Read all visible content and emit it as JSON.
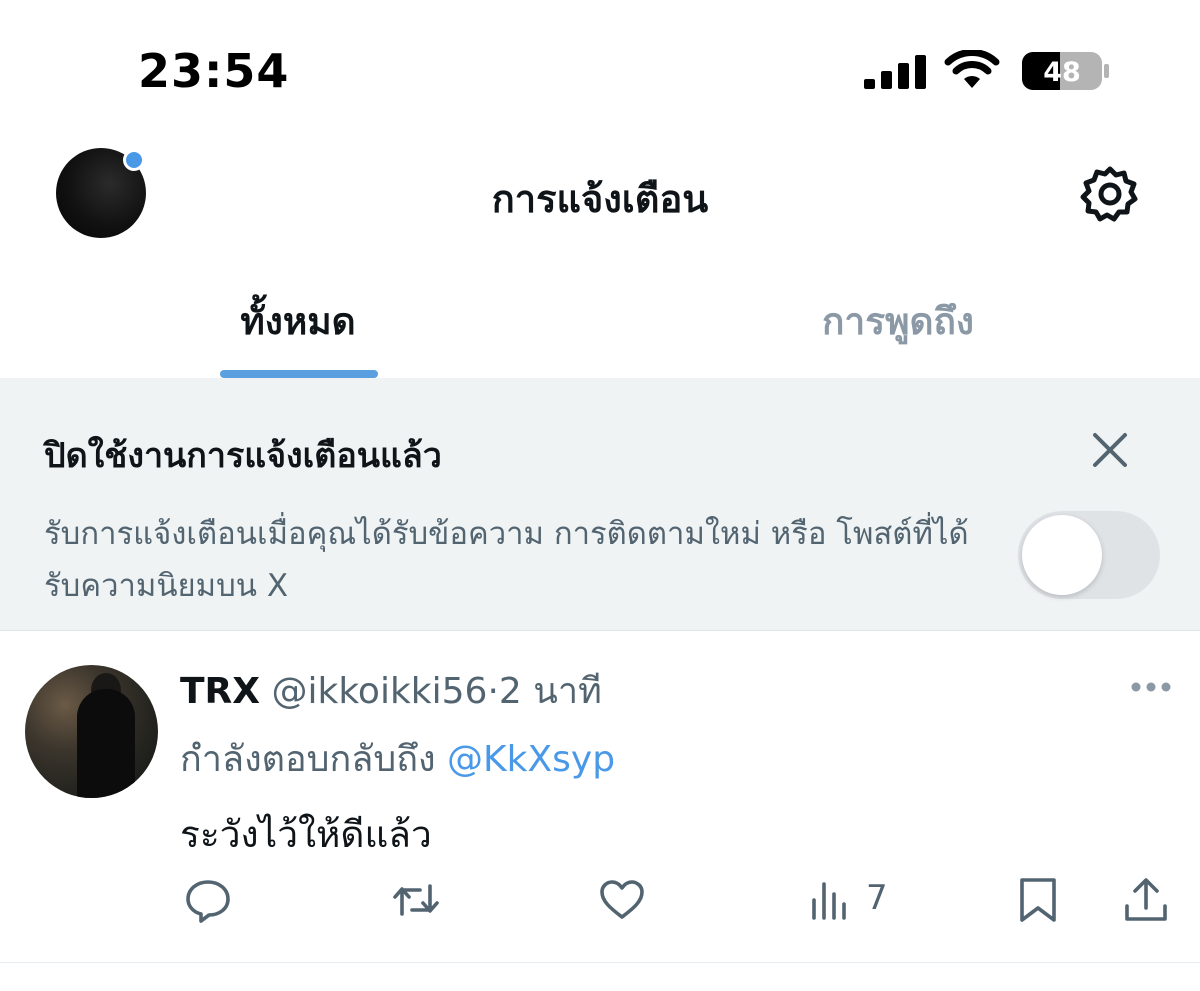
{
  "status_bar": {
    "time": "23:54",
    "battery": "48"
  },
  "header": {
    "title": "การแจ้งเตือน"
  },
  "tabs": [
    {
      "label": "ทั้งหมด"
    },
    {
      "label": "การพูดถึง"
    }
  ],
  "banner": {
    "title": "ปิดใช้งานการแจ้งเตือนแล้ว",
    "description": "รับการแจ้งเตือนเมื่อคุณได้รับข้อความ การติดตามใหม่ หรือ โพสต์ที่ได้รับความนิยมบน X",
    "toggle_on": false
  },
  "post": {
    "author_name": "TRX",
    "author_handle": "@ikkoikki56",
    "separator": "·",
    "time": "2 นาที",
    "reply_prefix": "กำลังตอบกลับถึง",
    "reply_to": "@KkXsyp",
    "text": "ระวังไว้ให้ดีแล้ว",
    "views": "7"
  },
  "icons": {
    "settings": "gear-icon",
    "close": "close-icon",
    "more": "more-icon",
    "reply": "reply-icon",
    "repost": "repost-icon",
    "like": "like-icon",
    "views": "views-icon",
    "bookmark": "bookmark-icon",
    "share": "share-icon"
  },
  "colors": {
    "accent": "#4a99e9",
    "muted": "#536471",
    "banner_bg": "#eff3f4"
  }
}
